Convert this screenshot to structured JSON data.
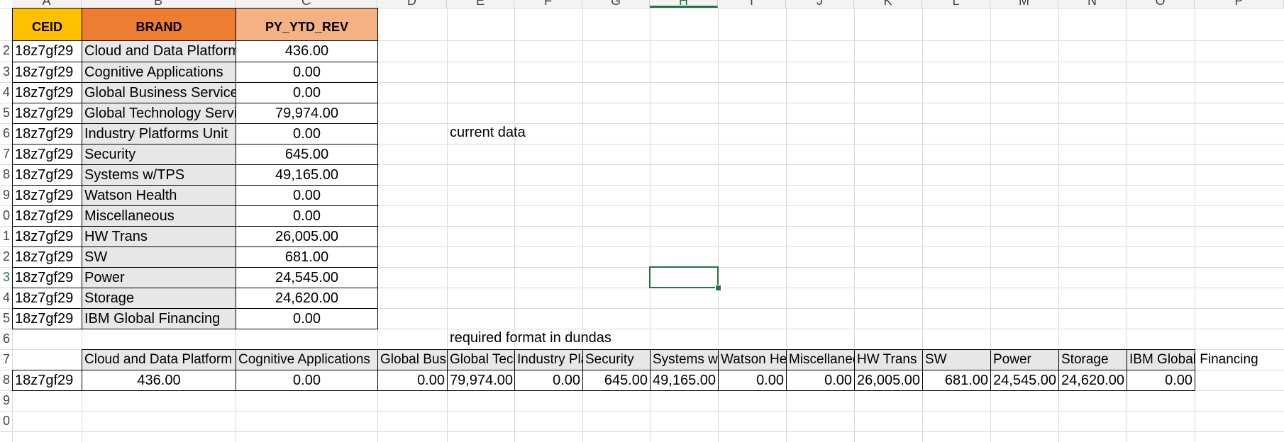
{
  "sheet": {
    "columns": [
      "A",
      "B",
      "C",
      "D",
      "E",
      "F",
      "G",
      "H",
      "I",
      "J",
      "K",
      "L",
      "M",
      "N",
      "O",
      "P"
    ],
    "selected_column": "H",
    "rows": [
      "2",
      "3",
      "4",
      "5",
      "6",
      "7",
      "8",
      "9",
      "0",
      "1",
      "2",
      "3",
      "4",
      "5",
      "6",
      "7",
      "8",
      "9",
      "0"
    ],
    "selected_row_index": 11
  },
  "table1": {
    "headers": {
      "ceid": "CEID",
      "brand": "BRAND",
      "rev": "PY_YTD_REV"
    },
    "header_colors": {
      "ceid": "#ffc000",
      "brand": "#ed7d31",
      "rev": "#f4b183"
    },
    "rows": [
      {
        "ceid": "18z7gf29",
        "brand": "Cloud and Data Platform",
        "rev": "436.00"
      },
      {
        "ceid": "18z7gf29",
        "brand": "Cognitive Applications",
        "rev": "0.00"
      },
      {
        "ceid": "18z7gf29",
        "brand": "Global Business Services",
        "rev": "0.00"
      },
      {
        "ceid": "18z7gf29",
        "brand": "Global Technology Services",
        "rev": "79,974.00"
      },
      {
        "ceid": "18z7gf29",
        "brand": "Industry Platforms Unit",
        "rev": "0.00"
      },
      {
        "ceid": "18z7gf29",
        "brand": "Security",
        "rev": "645.00"
      },
      {
        "ceid": "18z7gf29",
        "brand": "Systems w/TPS",
        "rev": "49,165.00"
      },
      {
        "ceid": "18z7gf29",
        "brand": "Watson Health",
        "rev": "0.00"
      },
      {
        "ceid": "18z7gf29",
        "brand": "Miscellaneous",
        "rev": "0.00"
      },
      {
        "ceid": "18z7gf29",
        "brand": "HW Trans",
        "rev": "26,005.00"
      },
      {
        "ceid": "18z7gf29",
        "brand": "SW",
        "rev": "681.00"
      },
      {
        "ceid": "18z7gf29",
        "brand": "Power",
        "rev": "24,545.00"
      },
      {
        "ceid": "18z7gf29",
        "brand": "Storage",
        "rev": "24,620.00"
      },
      {
        "ceid": "18z7gf29",
        "brand": "IBM Global Financing",
        "rev": "0.00"
      }
    ]
  },
  "notes": {
    "current": "current data",
    "required": "required format in dundas"
  },
  "table2": {
    "headers": [
      "Cloud and Data Platform",
      "Cognitive Applications",
      "Global Business Services",
      "Global Technology Services",
      "Industry Platforms Unit",
      "Security",
      "Systems w/TPS",
      "Watson Health",
      "Miscellaneous",
      "HW Trans",
      "SW",
      "Power",
      "Storage",
      "IBM Global Financing"
    ],
    "ceid": "18z7gf29",
    "values": [
      "436.00",
      "0.00",
      "0.00",
      "79,974.00",
      "0.00",
      "645.00",
      "49,165.00",
      "0.00",
      "0.00",
      "26,005.00",
      "681.00",
      "24,545.00",
      "24,620.00",
      "0.00"
    ]
  }
}
